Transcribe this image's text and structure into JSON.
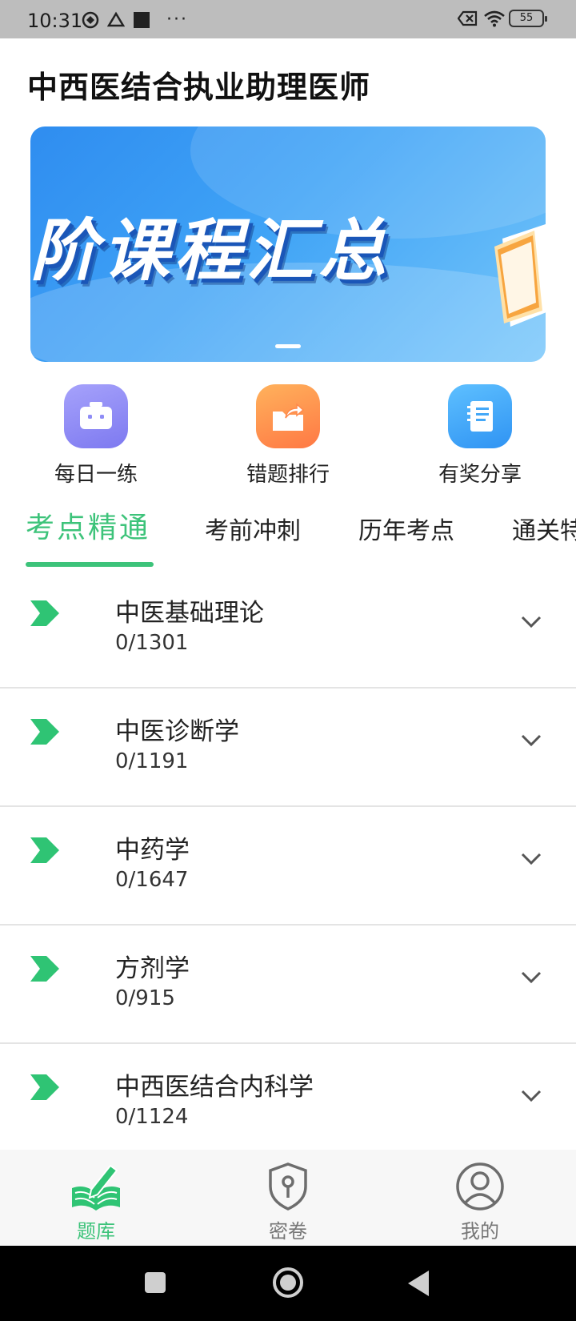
{
  "status_bar": {
    "time": "10:31",
    "dots": "···",
    "battery": "55",
    "icons": [
      "app-icon",
      "drive-icon",
      "square-icon",
      "sim-blocked-icon",
      "wifi-icon",
      "battery-icon"
    ]
  },
  "header": {
    "title": "中西医结合执业助理医师"
  },
  "banner": {
    "text": "阶课程汇总",
    "slide_index": 1
  },
  "quick_actions": [
    {
      "label": "每日一练",
      "icon": "robot-icon",
      "color": "#8f8cf6"
    },
    {
      "label": "错题排行",
      "icon": "share-folder-icon",
      "color": "#ff8a4c"
    },
    {
      "label": "有奖分享",
      "icon": "notebook-icon",
      "color": "#44a8f8"
    }
  ],
  "tabs": [
    {
      "label": "考点精通",
      "active": true
    },
    {
      "label": "考前冲刺",
      "active": false
    },
    {
      "label": "历年考点",
      "active": false
    },
    {
      "label": "通关特",
      "active": false
    }
  ],
  "list": [
    {
      "title": "中医基础理论",
      "count": "0/1301"
    },
    {
      "title": "中医诊断学",
      "count": "0/1191"
    },
    {
      "title": "中药学",
      "count": "0/1647"
    },
    {
      "title": "方剂学",
      "count": "0/915"
    },
    {
      "title": "中西医结合内科学",
      "count": "0/1124"
    }
  ],
  "bottom_nav": [
    {
      "label": "题库",
      "icon": "book-pencil-icon",
      "active": true
    },
    {
      "label": "密卷",
      "icon": "shield-key-icon",
      "active": false
    },
    {
      "label": "我的",
      "icon": "user-circle-icon",
      "active": false
    }
  ],
  "colors": {
    "accent": "#3dc37a",
    "banner_blue": "#3fa3f6",
    "status_bar": "#bdbdbd"
  }
}
